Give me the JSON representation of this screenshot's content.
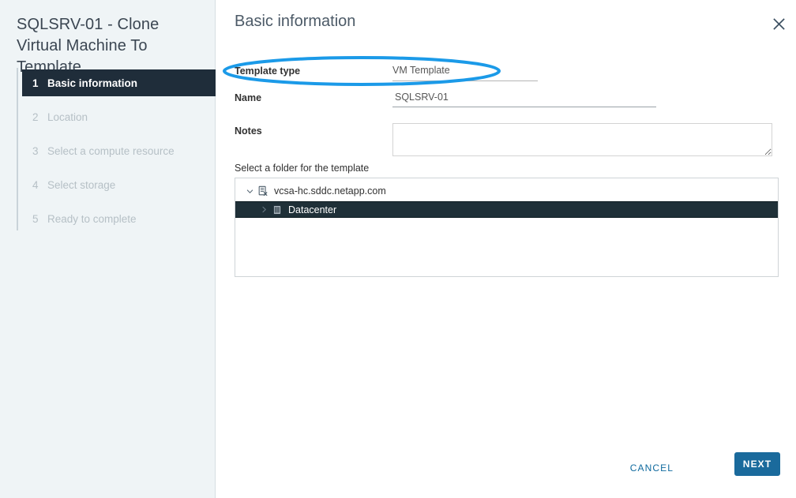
{
  "wizard": {
    "title": "SQLSRV-01 - Clone Virtual Machine To Template",
    "steps": [
      {
        "num": "1",
        "label": "Basic information",
        "state": "active"
      },
      {
        "num": "2",
        "label": "Location",
        "state": "disabled"
      },
      {
        "num": "3",
        "label": "Select a compute resource",
        "state": "disabled"
      },
      {
        "num": "4",
        "label": "Select storage",
        "state": "disabled"
      },
      {
        "num": "5",
        "label": "Ready to complete",
        "state": "disabled"
      }
    ]
  },
  "panel": {
    "title": "Basic information",
    "close_icon": "close-icon"
  },
  "form": {
    "template_type": {
      "label": "Template type",
      "value": "VM Template"
    },
    "name": {
      "label": "Name",
      "value": "SQLSRV-01",
      "placeholder": ""
    },
    "notes": {
      "label": "Notes",
      "value": "",
      "placeholder": ""
    },
    "folder_caption": "Select a folder for the template"
  },
  "tree": {
    "root": {
      "label": "vcsa-hc.sddc.netapp.com",
      "icon": "vcenter-server-icon",
      "twisty": "chevron-down-icon",
      "expanded": true
    },
    "children": [
      {
        "label": "Datacenter",
        "icon": "datacenter-icon",
        "twisty": "chevron-right-icon",
        "expanded": false,
        "selected": true
      }
    ]
  },
  "footer": {
    "cancel_label": "CANCEL",
    "next_label": "NEXT"
  },
  "annotation": {
    "type": "ellipse-highlight",
    "target": "template-type-row",
    "color": "#1b9ae8"
  },
  "colors": {
    "accent": "#1a6a9c",
    "link": "#0f6a9e",
    "sidebar_bg": "#eff4f6",
    "active_step_bg": "#1f2d3a",
    "selected_row_bg": "#1f3038",
    "annotation": "#1b9ae8"
  }
}
